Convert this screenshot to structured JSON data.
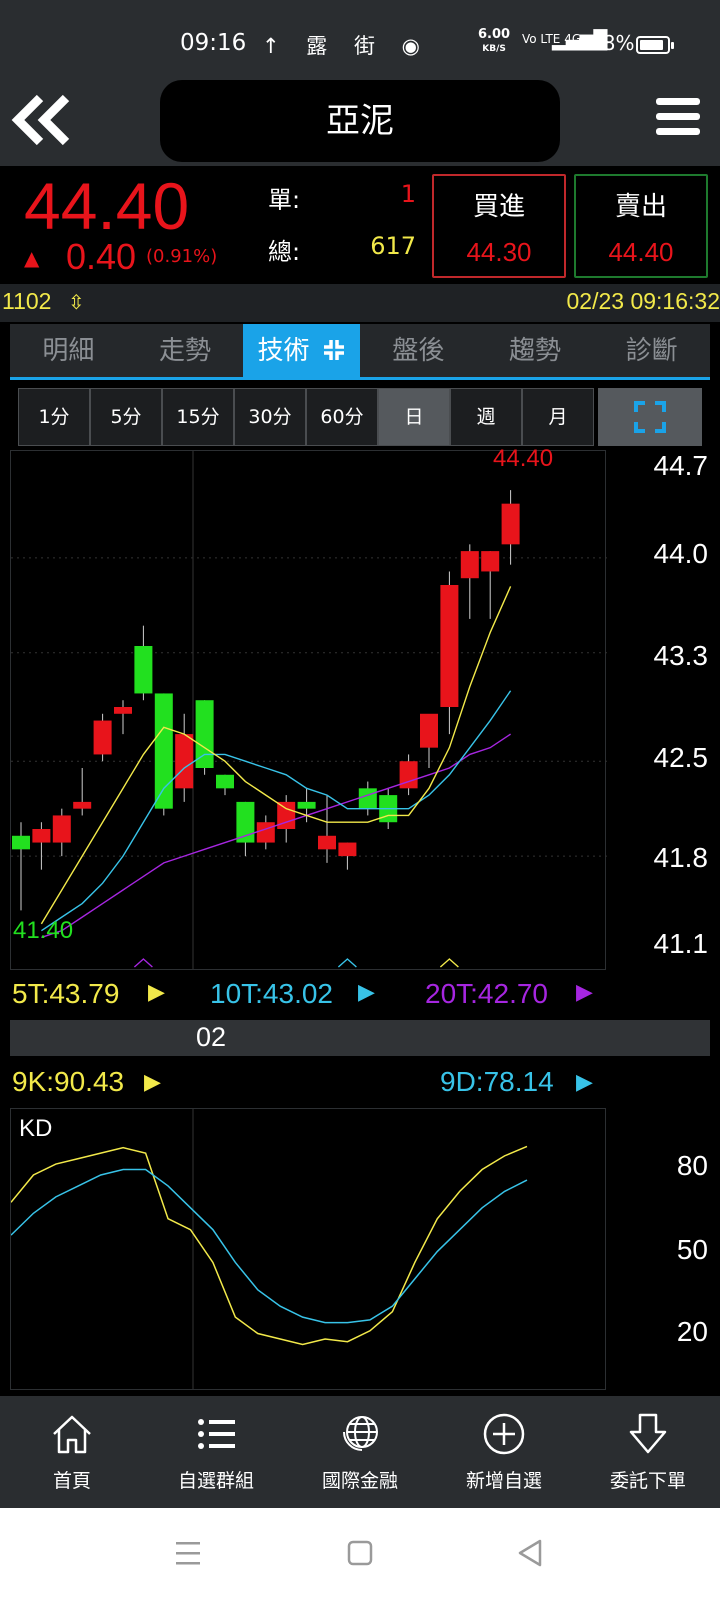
{
  "status": {
    "time": "09:16",
    "icons": "↑ 露 街 ◉",
    "speed_value": "6.00",
    "speed_unit": "KB/S",
    "net": "Vo LTE 4G",
    "battery": "88%",
    "battery_level": 0.88
  },
  "header": {
    "title": "亞泥"
  },
  "quote": {
    "price": "44.40",
    "change_arrow": "▲",
    "change": "0.40",
    "change_pct": "(0.91%)",
    "single_label": "單:",
    "single_value": "1",
    "total_label": "總:",
    "total_value": "617",
    "buy_label": "買進",
    "buy_price": "44.30",
    "sell_label": "賣出",
    "sell_price": "44.40"
  },
  "strip": {
    "volume": "1102",
    "volume_icon": "⇳",
    "datetime": "02/23 09:16:32"
  },
  "tabs": [
    {
      "label": "明細"
    },
    {
      "label": "走勢"
    },
    {
      "label": "技術"
    },
    {
      "label": "盤後"
    },
    {
      "label": "趨勢"
    },
    {
      "label": "診斷"
    }
  ],
  "periods": [
    "1分",
    "5分",
    "15分",
    "30分",
    "60分",
    "日",
    "週",
    "月"
  ],
  "selected_period": "日",
  "price_chart": {
    "y_labels": [
      "44.7",
      "44.0",
      "43.3",
      "42.5",
      "41.8",
      "41.1"
    ],
    "high_label": "44.40",
    "low_label": "41.40"
  },
  "ma": {
    "ma5": "5T:43.79",
    "ma10": "10T:43.02",
    "ma20": "20T:42.70"
  },
  "subbar_label": "02",
  "kd": {
    "k": "9K:90.43",
    "d": "9D:78.14",
    "title": "KD",
    "y_labels": [
      "80",
      "50",
      "20"
    ]
  },
  "nav": [
    {
      "label": "首頁",
      "icon": "home-icon"
    },
    {
      "label": "自選群組",
      "icon": "list-icon"
    },
    {
      "label": "國際金融",
      "icon": "globe-icon"
    },
    {
      "label": "新增自選",
      "icon": "add-circle-icon"
    },
    {
      "label": "委託下單",
      "icon": "order-arrow-icon"
    }
  ],
  "colors": {
    "up": "#e8141b",
    "down": "#22e01f",
    "ma5": "#f2e94a",
    "ma10": "#38c3e8",
    "ma20": "#a626e0",
    "accent": "#1aa3e8"
  },
  "chart_data": [
    {
      "type": "candlestick",
      "y_range": [
        41.1,
        44.7
      ],
      "candles": [
        {
          "o": 41.95,
          "h": 42.05,
          "l": 41.4,
          "c": 41.85
        },
        {
          "o": 41.9,
          "h": 42.05,
          "l": 41.7,
          "c": 42.0
        },
        {
          "o": 41.9,
          "h": 42.15,
          "l": 41.8,
          "c": 42.1
        },
        {
          "o": 42.15,
          "h": 42.45,
          "l": 42.1,
          "c": 42.2
        },
        {
          "o": 42.55,
          "h": 42.85,
          "l": 42.5,
          "c": 42.8
        },
        {
          "o": 42.85,
          "h": 42.95,
          "l": 42.7,
          "c": 42.9
        },
        {
          "o": 43.35,
          "h": 43.5,
          "l": 42.95,
          "c": 43.0
        },
        {
          "o": 43.0,
          "h": 43.0,
          "l": 42.1,
          "c": 42.15
        },
        {
          "o": 42.3,
          "h": 42.85,
          "l": 42.2,
          "c": 42.7
        },
        {
          "o": 42.95,
          "h": 42.95,
          "l": 42.4,
          "c": 42.45
        },
        {
          "o": 42.4,
          "h": 42.4,
          "l": 42.25,
          "c": 42.3
        },
        {
          "o": 42.2,
          "h": 42.2,
          "l": 41.8,
          "c": 41.9
        },
        {
          "o": 41.9,
          "h": 42.1,
          "l": 41.85,
          "c": 42.05
        },
        {
          "o": 42.0,
          "h": 42.25,
          "l": 41.9,
          "c": 42.2
        },
        {
          "o": 42.2,
          "h": 42.3,
          "l": 42.05,
          "c": 42.15
        },
        {
          "o": 41.85,
          "h": 42.25,
          "l": 41.75,
          "c": 41.95
        },
        {
          "o": 41.8,
          "h": 41.9,
          "l": 41.7,
          "c": 41.9
        },
        {
          "o": 42.3,
          "h": 42.35,
          "l": 42.1,
          "c": 42.15
        },
        {
          "o": 42.25,
          "h": 42.3,
          "l": 42.0,
          "c": 42.05
        },
        {
          "o": 42.3,
          "h": 42.55,
          "l": 42.25,
          "c": 42.5
        },
        {
          "o": 42.6,
          "h": 42.65,
          "l": 42.45,
          "c": 42.85
        },
        {
          "o": 42.9,
          "h": 43.9,
          "l": 42.7,
          "c": 43.8
        },
        {
          "o": 43.85,
          "h": 44.1,
          "l": 43.55,
          "c": 44.05
        },
        {
          "o": 43.9,
          "h": 44.05,
          "l": 43.55,
          "c": 44.05
        },
        {
          "o": 44.1,
          "h": 44.5,
          "l": 43.95,
          "c": 44.4
        }
      ],
      "ma5": [
        null,
        41.3,
        41.55,
        41.8,
        42.05,
        42.3,
        42.55,
        42.75,
        42.7,
        42.6,
        42.5,
        42.35,
        42.25,
        42.15,
        42.1,
        42.05,
        42.05,
        42.05,
        42.1,
        42.1,
        42.3,
        42.6,
        43.05,
        43.45,
        43.79
      ],
      "ma10": [
        null,
        41.25,
        41.35,
        41.45,
        41.6,
        41.8,
        42.05,
        42.3,
        42.45,
        42.55,
        42.55,
        42.5,
        42.45,
        42.4,
        42.3,
        42.25,
        42.15,
        42.15,
        42.15,
        42.15,
        42.25,
        42.4,
        42.6,
        42.8,
        43.02
      ],
      "ma20": [
        null,
        41.2,
        41.25,
        41.35,
        41.45,
        41.55,
        41.65,
        41.75,
        41.8,
        41.85,
        41.9,
        41.95,
        42.0,
        42.05,
        42.1,
        42.15,
        42.2,
        42.25,
        42.3,
        42.35,
        42.4,
        42.45,
        42.55,
        42.6,
        42.7
      ]
    },
    {
      "type": "line",
      "title": "KD",
      "y_range": [
        0,
        100
      ],
      "series": [
        {
          "name": "9K",
          "values": [
            70,
            80,
            84,
            86,
            88,
            90,
            88,
            64,
            60,
            48,
            28,
            22,
            20,
            18,
            20,
            19,
            23,
            30,
            48,
            64,
            74,
            82,
            87,
            90.43
          ]
        },
        {
          "name": "9D",
          "values": [
            58,
            66,
            72,
            76,
            80,
            82,
            82,
            76,
            68,
            60,
            48,
            38,
            32,
            28,
            26,
            26,
            27,
            32,
            42,
            52,
            60,
            68,
            74,
            78.14
          ]
        }
      ]
    }
  ]
}
